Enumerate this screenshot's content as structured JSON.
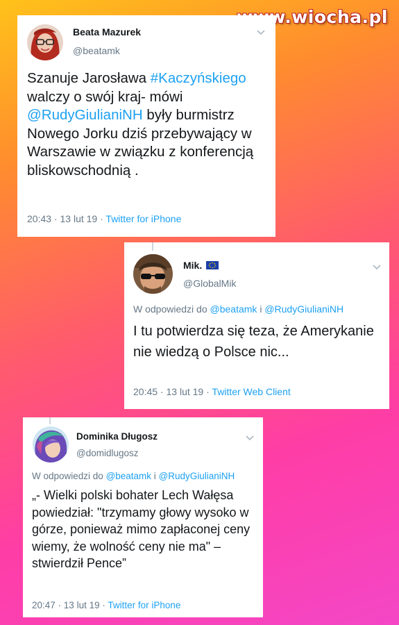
{
  "watermark": "www.wiocha.pl",
  "tweets": [
    {
      "name": "Beata Mazurek",
      "handle": "@beatamk",
      "text_parts": [
        "Szanuje Jarosława ",
        "#Kaczyńskiego",
        " walczy o swój kraj- mówi ",
        "@RudyGiulianiNH",
        " były burmistrz Nowego Jorku dziś przebywający w Warszawie w związku z konferencją bliskowschodnią ."
      ],
      "time": "20:43",
      "sep1": " · ",
      "date": "13 lut 19",
      "sep2": " · ",
      "source": "Twitter for iPhone",
      "menu_icon": "chevron-down-icon"
    },
    {
      "name": "Mik.",
      "flag": "🇪🇺",
      "handle": "@GlobalMik",
      "reply_prefix": "W odpowiedzi do ",
      "reply_to_1": "@beatamk",
      "reply_and": " i ",
      "reply_to_2": "@RudyGiulianiNH",
      "text": "I tu potwierdza się teza, że Amerykanie nie wiedzą o Polsce nic...",
      "time": "20:45",
      "sep1": " · ",
      "date": "13 lut 19",
      "sep2": " · ",
      "source": "Twitter Web Client",
      "menu_icon": "chevron-down-icon"
    },
    {
      "name": "Dominika Długosz",
      "handle": "@domidlugosz",
      "reply_prefix": "W odpowiedzi do ",
      "reply_to_1": "@beatamk",
      "reply_and": " i ",
      "reply_to_2": "@RudyGiulianiNH",
      "text": "„- Wielki polski bohater Lech Wałęsa powiedział: \"trzymamy głowy wysoko w górze, ponieważ mimo zapłaconej ceny wiemy, że wolność ceny nie ma\" – stwierdził Pence”",
      "time": "20:47",
      "sep1": " · ",
      "date": "13 lut 19",
      "sep2": " · ",
      "source": "Twitter for iPhone",
      "menu_icon": "chevron-down-icon"
    }
  ],
  "colors": {
    "link": "#1da1f2",
    "text": "#14171a",
    "muted": "#657786"
  }
}
